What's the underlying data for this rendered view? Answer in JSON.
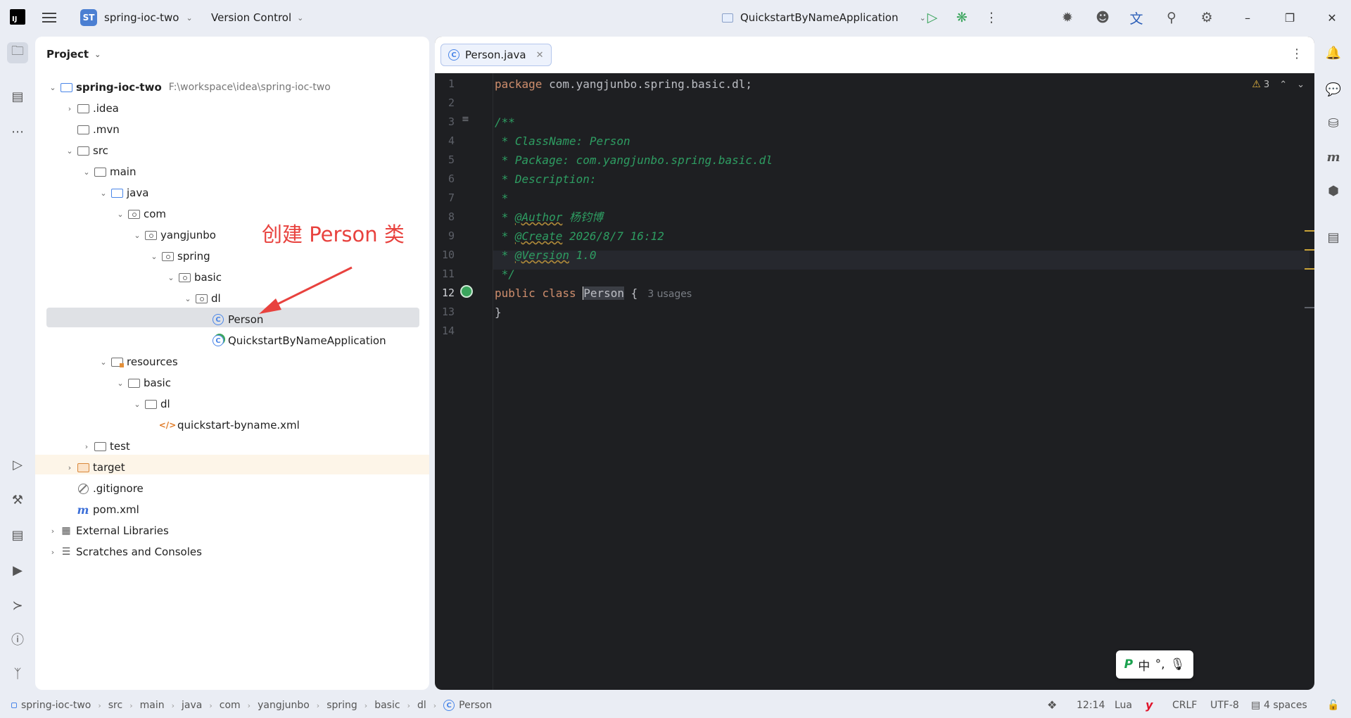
{
  "titlebar": {
    "project_badge": "ST",
    "project_name": "spring-ioc-two",
    "vcs_label": "Version Control",
    "run_config": "QuickstartByNameApplication",
    "logo_text": "IJ"
  },
  "project_panel": {
    "title": "Project",
    "tree": [
      {
        "label": "spring-ioc-two",
        "hint": "F:\\workspace\\idea\\spring-ioc-two"
      },
      {
        "label": ".idea"
      },
      {
        "label": ".mvn"
      },
      {
        "label": "src"
      },
      {
        "label": "main"
      },
      {
        "label": "java"
      },
      {
        "label": "com"
      },
      {
        "label": "yangjunbo"
      },
      {
        "label": "spring"
      },
      {
        "label": "basic"
      },
      {
        "label": "dl"
      },
      {
        "label": "Person"
      },
      {
        "label": "QuickstartByNameApplication"
      },
      {
        "label": "resources"
      },
      {
        "label": "basic"
      },
      {
        "label": "dl"
      },
      {
        "label": "quickstart-byname.xml"
      },
      {
        "label": "test"
      },
      {
        "label": "target"
      },
      {
        "label": ".gitignore"
      },
      {
        "label": "pom.xml"
      },
      {
        "label": "External Libraries"
      },
      {
        "label": "Scratches and Consoles"
      }
    ]
  },
  "annotation": "创建 Person 类",
  "editor": {
    "tab_label": "Person.java",
    "warnings_count": "3",
    "line_numbers": [
      "1",
      "2",
      "3",
      "4",
      "5",
      "6",
      "7",
      "8",
      "9",
      "10",
      "11",
      "12",
      "13",
      "14"
    ],
    "code": {
      "l1_kw": "package",
      "l1_rest": " com.yangjunbo.spring.basic.dl;",
      "l3": "/**",
      "l4": " * ClassName: Person",
      "l5": " * Package: com.yangjunbo.spring.basic.dl",
      "l6": " * Description:",
      "l7": " *",
      "l8_pre": " * ",
      "l8_tag": "@Author",
      "l8_val": " 杨钧博",
      "l9_pre": " * ",
      "l9_tag": "@Create",
      "l9_val": " 2026/8/7 16:12",
      "l10_pre": " * ",
      "l10_tag": "@Version",
      "l10_val": " 1.0",
      "l11": " */",
      "l12_kw1": "public",
      "l12_kw2": "class",
      "l12_name": "Person",
      "l12_brace": " {",
      "l12_hint": "3 usages",
      "l13": "}"
    }
  },
  "ime": {
    "mode": "中",
    "punct": "°,"
  },
  "statusbar": {
    "breadcrumbs": [
      "spring-ioc-two",
      "src",
      "main",
      "java",
      "com",
      "yangjunbo",
      "spring",
      "basic",
      "dl",
      "Person"
    ],
    "position": "12:14",
    "language": "Lua",
    "line_sep": "CRLF",
    "encoding": "UTF-8",
    "indent": "4 spaces"
  }
}
